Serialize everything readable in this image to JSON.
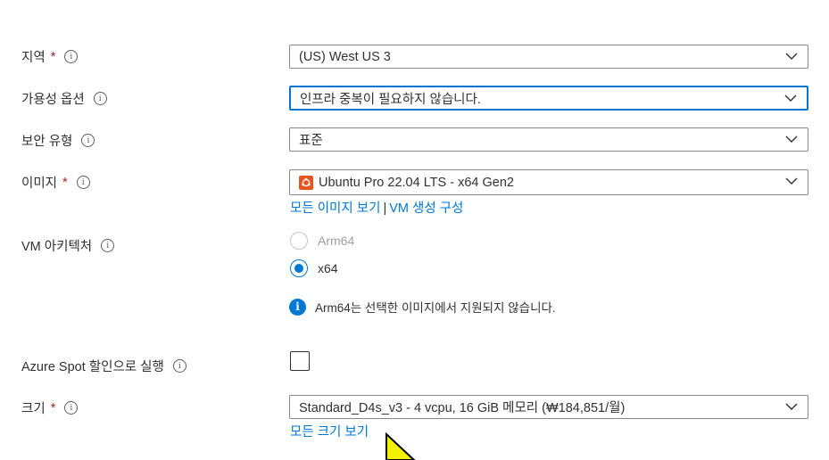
{
  "region": {
    "label": "지역",
    "required": "*",
    "value": "(US) West US 3"
  },
  "availability": {
    "label": "가용성 옵션",
    "value": "인프라 중복이 필요하지 않습니다."
  },
  "security": {
    "label": "보안 유형",
    "value": "표준"
  },
  "image": {
    "label": "이미지",
    "required": "*",
    "value": "Ubuntu Pro 22.04 LTS - x64 Gen2",
    "link_all": "모든 이미지 보기",
    "separator": "|",
    "link_config": "VM 생성 구성"
  },
  "architecture": {
    "label": "VM 아키텍처",
    "options": [
      {
        "label": "Arm64",
        "disabled": true
      },
      {
        "label": "x64",
        "checked": true
      }
    ],
    "info_message": "Arm64는 선택한 이미지에서 지원되지 않습니다."
  },
  "spot": {
    "label": "Azure Spot 할인으로 실행"
  },
  "size": {
    "label": "크기",
    "required": "*",
    "value": "Standard_D4s_v3 - 4 vcpu, 16 GiB 메모리 (₩184,851/월)",
    "link_all": "모든 크기 보기"
  },
  "icons": {
    "info": "info-icon",
    "chevron": "chevron-down-icon",
    "ubuntu": "ubuntu-logo-icon"
  },
  "colors": {
    "accent": "#0078d4",
    "required": "#a4262c",
    "ubuntu": "#e95420"
  }
}
